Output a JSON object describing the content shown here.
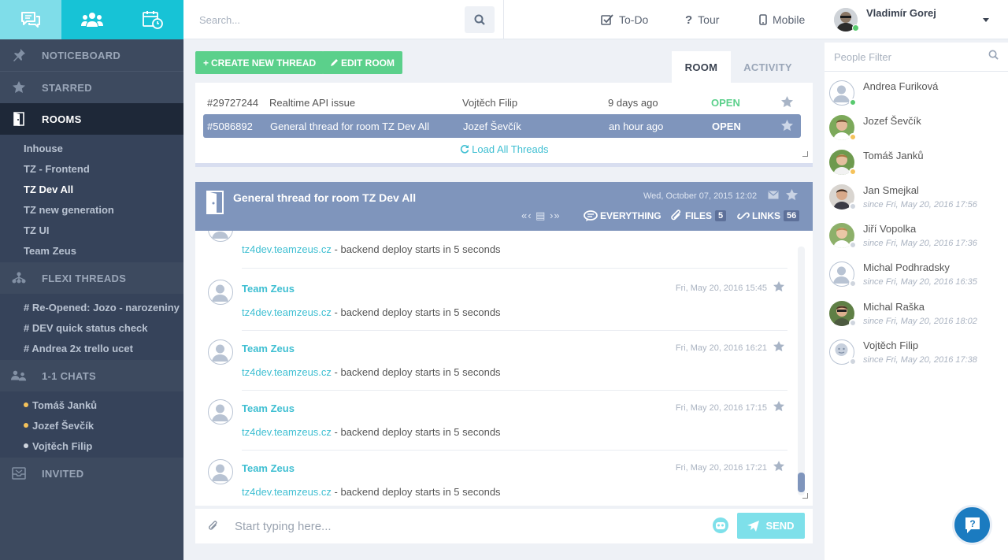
{
  "app_tabs": [
    {
      "name": "chat-icon",
      "active": true
    },
    {
      "name": "team-icon",
      "active": false
    },
    {
      "name": "calendar-icon",
      "active": false
    }
  ],
  "sidebar": {
    "noticeboard": "NOTICEBOARD",
    "starred": "STARRED",
    "rooms": "ROOMS",
    "room_items": [
      "Inhouse",
      "TZ - Frontend",
      "TZ Dev All",
      "TZ new generation",
      "TZ UI",
      "Team Zeus"
    ],
    "flexi_threads": "FLEXI THREADS",
    "flexi_items": [
      "# Re-Opened: Jozo - narozeniny",
      "# DEV quick status check",
      "# Andrea 2x trello ucet"
    ],
    "chats": "1-1 CHATS",
    "chat_items": [
      "Tomáš Janků",
      "Jozef Ševčík",
      "Vojtěch Filip"
    ],
    "invited": "INVITED"
  },
  "header": {
    "search_placeholder": "Search...",
    "todo": "To-Do",
    "tour": "Tour",
    "mobile": "Mobile",
    "user_name": "Vladimír Gorej"
  },
  "actions": {
    "create_thread": "CREATE NEW THREAD",
    "edit_room": "EDIT ROOM"
  },
  "tabs": {
    "room": "ROOM",
    "activity": "ACTIVITY"
  },
  "threads": [
    {
      "id": "#29727244",
      "title": "Realtime API issue",
      "author": "Vojtěch Filip",
      "time": "9 days ago",
      "status": "OPEN"
    },
    {
      "id": "#5086892",
      "title": "General thread for room TZ Dev All",
      "author": "Jozef Ševčík",
      "time": "an hour ago",
      "status": "OPEN"
    }
  ],
  "load_all": "Load All Threads",
  "chat": {
    "title": "General thread for room TZ Dev All",
    "date": "Wed, October 07, 2015 12:02",
    "filter_everything": "EVERYTHING",
    "filter_files": "FILES",
    "files_count": "5",
    "filter_links": "LINKS",
    "links_count": "56",
    "partial_message": {
      "link": "tz4dev.teamzeus.cz",
      "text": " - backend deploy starts in 5 seconds"
    },
    "messages": [
      {
        "author": "Team Zeus",
        "time": "Fri, May 20, 2016 15:45",
        "link": "tz4dev.teamzeus.cz",
        "text": " - backend deploy starts in 5 seconds"
      },
      {
        "author": "Team Zeus",
        "time": "Fri, May 20, 2016 16:21",
        "link": "tz4dev.teamzeus.cz",
        "text": " - backend deploy starts in 5 seconds"
      },
      {
        "author": "Team Zeus",
        "time": "Fri, May 20, 2016 17:15",
        "link": "tz4dev.teamzeus.cz",
        "text": " - backend deploy starts in 5 seconds"
      },
      {
        "author": "Team Zeus",
        "time": "Fri, May 20, 2016 17:21",
        "link": "tz4dev.teamzeus.cz",
        "text": " - backend deploy starts in 5 seconds"
      }
    ]
  },
  "compose": {
    "placeholder": "Start typing here...",
    "send": "SEND"
  },
  "people": {
    "filter_placeholder": "People Filter",
    "list": [
      {
        "name": "Andrea Furiková",
        "since": "",
        "status_color": "#58c96e"
      },
      {
        "name": "Jozef Ševčík",
        "since": "",
        "status_color": "#f5c25a"
      },
      {
        "name": "Tomáš Janků",
        "since": "",
        "status_color": "#f5c25a"
      },
      {
        "name": "Jan Smejkal",
        "since": "since Fri, May 20, 2016 17:56",
        "status_color": "#cfd5de"
      },
      {
        "name": "Jiří Vopolka",
        "since": "since Fri, May 20, 2016 17:36",
        "status_color": "#cfd5de"
      },
      {
        "name": "Michal Podhradsky",
        "since": "since Fri, May 20, 2016 16:35",
        "status_color": "#cfd5de"
      },
      {
        "name": "Michal Raška",
        "since": "since Fri, May 20, 2016 18:02",
        "status_color": "#cfd5de"
      },
      {
        "name": "Vojtěch Filip",
        "since": "since Fri, May 20, 2016 17:38",
        "status_color": "#cfd5de"
      }
    ]
  },
  "colors": {
    "accent": "#17c3d6",
    "green": "#5bd08b",
    "sidebar": "#3d4a5f",
    "thread_header": "#7f95bc",
    "help": "#1b7bc0"
  }
}
